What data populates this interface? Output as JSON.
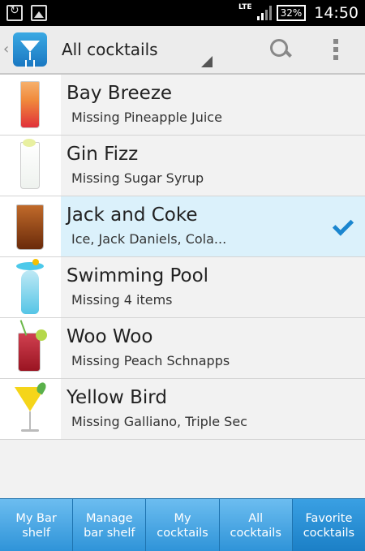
{
  "status_bar": {
    "network": "LTE",
    "battery": "32%",
    "time": "14:50",
    "icons": [
      "sync-icon",
      "image-icon",
      "signal-icon",
      "battery-icon"
    ]
  },
  "action_bar": {
    "title": "All cocktails",
    "icons": [
      "back-arrow-icon",
      "app-logo-icon",
      "dropdown-arrow-icon",
      "search-icon",
      "overflow-menu-icon"
    ]
  },
  "cocktails": [
    {
      "name": "Bay Breeze",
      "subtitle": "Missing Pineapple Juice",
      "selected": false
    },
    {
      "name": "Gin Fizz",
      "subtitle": "Missing Sugar Syrup",
      "selected": false
    },
    {
      "name": "Jack and Coke",
      "subtitle": "Ice, Jack Daniels, Cola...",
      "selected": true
    },
    {
      "name": "Swimming Pool",
      "subtitle": "Missing 4 items",
      "selected": false
    },
    {
      "name": "Woo Woo",
      "subtitle": "Missing Peach Schnapps",
      "selected": false
    },
    {
      "name": "Yellow Bird",
      "subtitle": "Missing Galliano, Triple Sec",
      "selected": false
    }
  ],
  "bottom_tabs": [
    {
      "label": "My Bar shelf",
      "active": false
    },
    {
      "label": "Manage bar shelf",
      "active": false
    },
    {
      "label": "My cocktails",
      "active": false
    },
    {
      "label": "All cocktails",
      "active": false
    },
    {
      "label": "Favorite cocktails",
      "active": true
    }
  ],
  "colors": {
    "accent": "#1b86cf",
    "selected_row": "#dbf1fb",
    "tab_bar": "#2a8fd4"
  }
}
